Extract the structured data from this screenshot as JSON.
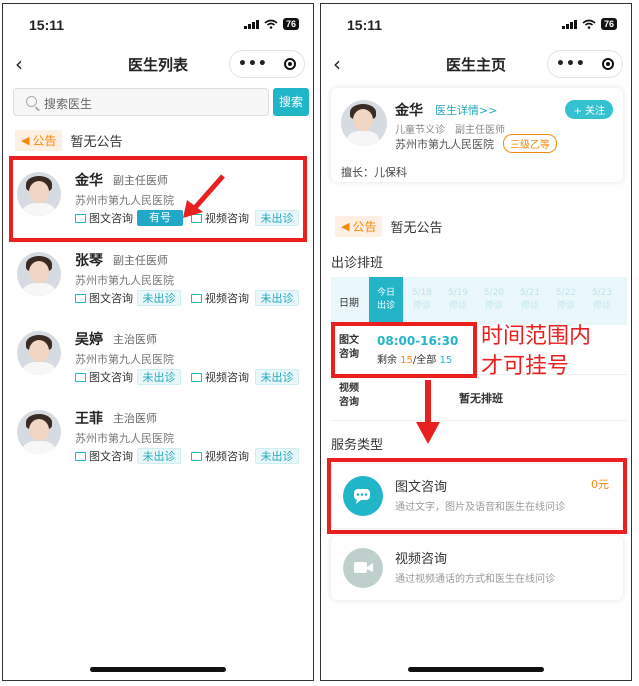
{
  "status": {
    "time": "15:11",
    "battery": "76"
  },
  "left": {
    "title": "医生列表",
    "search": {
      "placeholder": "搜索医生",
      "button": "搜索"
    },
    "notice": {
      "tag": "公告",
      "text": "暂无公告"
    },
    "doctors": [
      {
        "name": "金华",
        "title": "副主任医师",
        "hospital": "苏州市第九人民医院",
        "svc1": "图文咨询",
        "svc1_status": "有号",
        "svc2": "视频咨询",
        "svc2_status": "未出诊"
      },
      {
        "name": "张琴",
        "title": "副主任医师",
        "hospital": "苏州市第九人民医院",
        "svc1": "图文咨询",
        "svc1_status": "未出诊",
        "svc2": "视频咨询",
        "svc2_status": "未出诊"
      },
      {
        "name": "吴婷",
        "title": "主治医师",
        "hospital": "苏州市第九人民医院",
        "svc1": "图文咨询",
        "svc1_status": "未出诊",
        "svc2": "视频咨询",
        "svc2_status": "未出诊"
      },
      {
        "name": "王菲",
        "title": "主治医师",
        "hospital": "苏州市第九人民医院",
        "svc1": "图文咨询",
        "svc1_status": "未出诊",
        "svc2": "视频咨询",
        "svc2_status": "未出诊"
      }
    ]
  },
  "right": {
    "title": "医生主页",
    "doctor": {
      "name": "金华",
      "detail_link": "医生详情>>",
      "follow": "+ 关注",
      "dept": "儿童节义诊",
      "title": "副主任医师",
      "hospital": "苏州市第九人民医院",
      "grade": "三级乙等",
      "specialty": "擅长：儿保科"
    },
    "notice": {
      "tag": "公告",
      "text": "暂无公告"
    },
    "schedule": {
      "heading": "出诊排班",
      "date_label": "日期",
      "days": [
        {
          "date": "今日",
          "status": "出诊"
        },
        {
          "date": "5/18",
          "status": "停诊"
        },
        {
          "date": "5/19",
          "status": "停诊"
        },
        {
          "date": "5/20",
          "status": "停诊"
        },
        {
          "date": "5/21",
          "status": "停诊"
        },
        {
          "date": "5/22",
          "status": "停诊"
        },
        {
          "date": "5/23",
          "status": "停诊"
        }
      ],
      "row1_label": "图文\n咨询",
      "row1_time": "08:00-16:30",
      "row1_remain_label": "剩余",
      "row1_remain": "15",
      "row1_total_label": "/全部",
      "row1_total": "15",
      "row2_label": "视频\n咨询",
      "row2_text": "暂无排班"
    },
    "annotation": {
      "line1": "时间范围内",
      "line2": "才可挂号"
    },
    "services": {
      "heading": "服务类型",
      "items": [
        {
          "name": "图文咨询",
          "desc": "通过文字，图片及语音和医生在线问诊",
          "price": "0元"
        },
        {
          "name": "视频咨询",
          "desc": "通过视频通话的方式和医生在线问诊",
          "price": ""
        }
      ]
    }
  },
  "colors": {
    "accent": "#21b5c8",
    "orange": "#f28a0f",
    "red": "#ea1f1f"
  }
}
